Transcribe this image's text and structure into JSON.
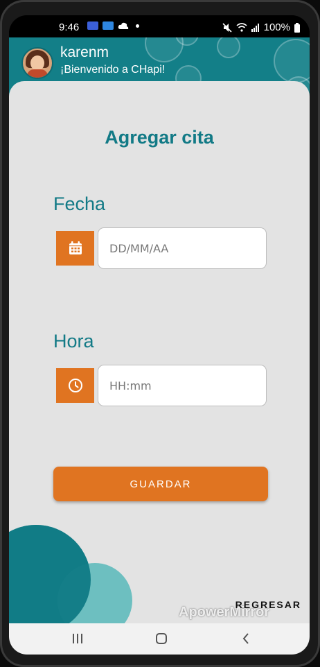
{
  "status_bar": {
    "time": "9:46",
    "battery": "100%",
    "icons": [
      "notification-app-icon",
      "photos-app-icon",
      "cloud-icon",
      "dot-icon",
      "mute-icon",
      "wifi-icon",
      "signal-icon",
      "battery-icon"
    ]
  },
  "header": {
    "username": "karenm",
    "welcome": "¡Bienvenido a CHapi!",
    "accent": "#137f88"
  },
  "form": {
    "title": "Agregar cita",
    "date_label": "Fecha",
    "date_placeholder": "DD/MM/AA",
    "date_icon": "calendar-icon",
    "time_label": "Hora",
    "time_placeholder": "HH:mm",
    "time_icon": "clock-icon",
    "save_label": "GUARDAR",
    "back_label": "REGRESAR",
    "button_color": "#e07421"
  },
  "watermark": "ApowerMirror",
  "nav_bar": {
    "icons": [
      "recent-apps-icon",
      "home-icon",
      "back-icon"
    ]
  }
}
